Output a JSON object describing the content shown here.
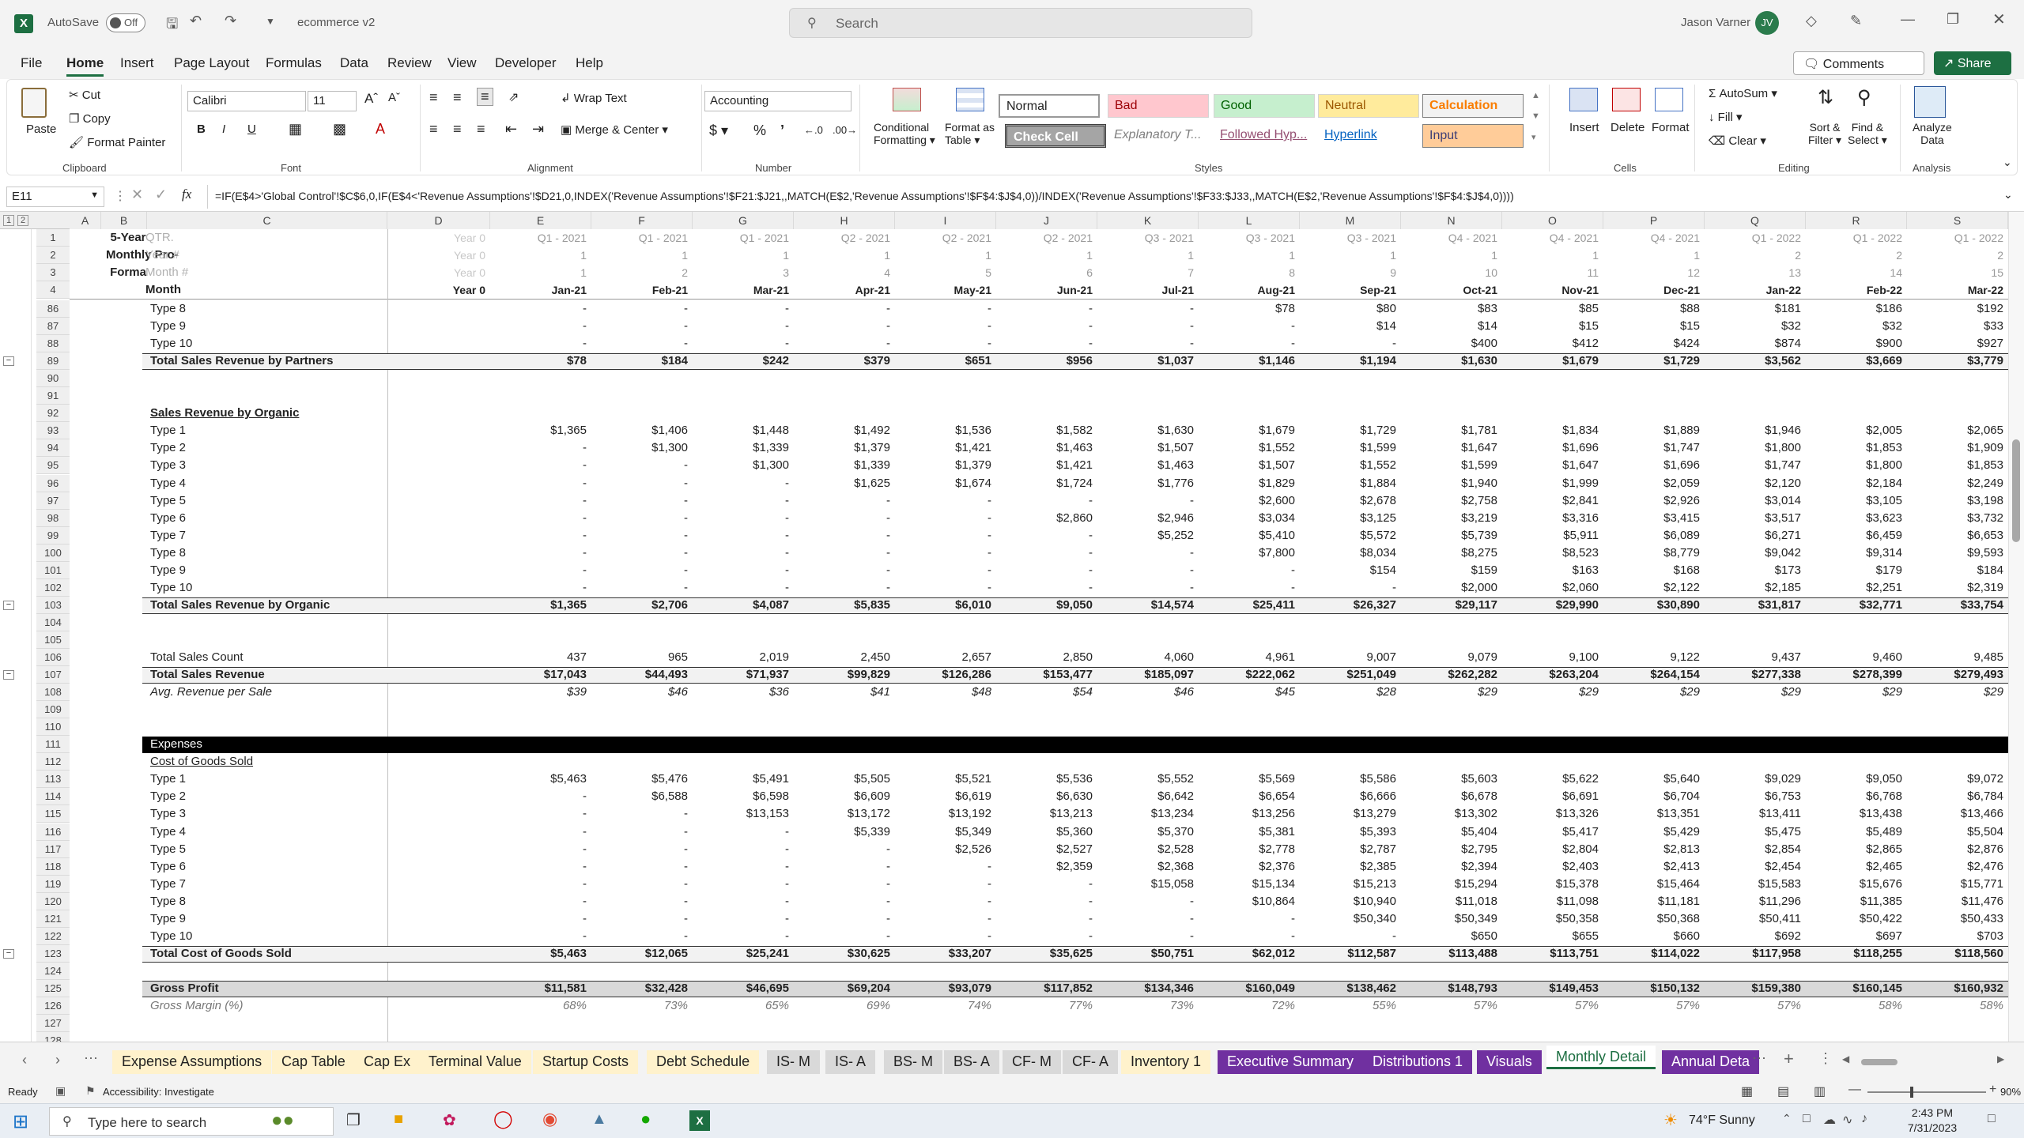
{
  "titlebar": {
    "autosave": "AutoSave",
    "autosave_state": "Off",
    "filename": "ecommerce v2",
    "search_placeholder": "Search",
    "user": "Jason Varner",
    "initials": "JV"
  },
  "menu": [
    "File",
    "Home",
    "Insert",
    "Page Layout",
    "Formulas",
    "Data",
    "Review",
    "View",
    "Developer",
    "Help"
  ],
  "menu_right": {
    "comments": "Comments",
    "share": "Share"
  },
  "ribbon": {
    "paste": "Paste",
    "cut": "Cut",
    "copy": "Copy",
    "format_painter": "Format Painter",
    "clipboard": "Clipboard",
    "font_name": "Calibri",
    "font_size": "11",
    "font": "Font",
    "wrap_text": "Wrap Text",
    "merge_center": "Merge & Center",
    "alignment": "Alignment",
    "number_format": "Accounting",
    "number": "Number",
    "cond_format": "Conditional",
    "cond_format2": "Formatting",
    "format_table": "Format as",
    "format_table2": "Table",
    "styles": [
      "Normal",
      "Bad",
      "Good",
      "Neutral",
      "Calculation",
      "Check Cell",
      "Explanatory T...",
      "Followed Hyp...",
      "Hyperlink",
      "Input"
    ],
    "styles_label": "Styles",
    "insert": "Insert",
    "delete": "Delete",
    "format": "Format",
    "cells": "Cells",
    "autosum": "AutoSum",
    "fill": "Fill",
    "clear": "Clear",
    "sort_filter": "Sort &",
    "sort_filter2": "Filter",
    "find_select": "Find &",
    "find_select2": "Select",
    "editing": "Editing",
    "analyze": "Analyze",
    "analyze2": "Data",
    "analysis": "Analysis"
  },
  "formula_bar": {
    "name_box": "E11",
    "fx": "fx",
    "formula": "=IF(E$4>'Global Control'!$C$6,0,IF(E$4<'Revenue Assumptions'!$D21,0,INDEX('Revenue Assumptions'!$F21:$J21,,MATCH(E$2,'Revenue Assumptions'!$F$4:$J$4,0))/INDEX('Revenue Assumptions'!$F33:$J33,,MATCH(E$2,'Revenue Assumptions'!$F$4:$J$4,0))))"
  },
  "columns": [
    "A",
    "B",
    "C",
    "D",
    "E",
    "F",
    "G",
    "H",
    "I",
    "J",
    "K",
    "L",
    "M",
    "N",
    "O",
    "P",
    "Q",
    "R",
    "S"
  ],
  "header_rows": {
    "label_b": [
      "5-Year",
      "Monthly Pro-",
      "Forma"
    ],
    "label_c": [
      "QTR.",
      "Year #",
      "Month #",
      "Month"
    ],
    "qtr": [
      "Year 0",
      "Q1 - 2021",
      "Q1 - 2021",
      "Q1 - 2021",
      "Q2 - 2021",
      "Q2 - 2021",
      "Q2 - 2021",
      "Q3 - 2021",
      "Q3 - 2021",
      "Q3 - 2021",
      "Q4 - 2021",
      "Q4 - 2021",
      "Q4 - 2021",
      "Q1 - 2022",
      "Q1 - 2022",
      "Q1 - 2022"
    ],
    "year": [
      "Year 0",
      "1",
      "1",
      "1",
      "1",
      "1",
      "1",
      "1",
      "1",
      "1",
      "1",
      "1",
      "1",
      "2",
      "2",
      "2"
    ],
    "monthnum": [
      "Year 0",
      "1",
      "2",
      "3",
      "4",
      "5",
      "6",
      "7",
      "8",
      "9",
      "10",
      "11",
      "12",
      "13",
      "14",
      "15"
    ],
    "month": [
      "Year 0",
      "Jan-21",
      "Feb-21",
      "Mar-21",
      "Apr-21",
      "May-21",
      "Jun-21",
      "Jul-21",
      "Aug-21",
      "Sep-21",
      "Oct-21",
      "Nov-21",
      "Dec-21",
      "Jan-22",
      "Feb-22",
      "Mar-22"
    ]
  },
  "rows": [
    {
      "n": "86",
      "label": "Type 8",
      "vals": [
        "",
        "-",
        "-",
        "-",
        "-",
        "-",
        "-",
        "-",
        "$78",
        "$80",
        "$83",
        "$85",
        "$88",
        "$181",
        "$186",
        "$192"
      ]
    },
    {
      "n": "87",
      "label": "Type 9",
      "vals": [
        "",
        "-",
        "-",
        "-",
        "-",
        "-",
        "-",
        "-",
        "-",
        "$14",
        "$14",
        "$15",
        "$15",
        "$32",
        "$32",
        "$33"
      ]
    },
    {
      "n": "88",
      "label": "Type 10",
      "vals": [
        "",
        "-",
        "-",
        "-",
        "-",
        "-",
        "-",
        "-",
        "-",
        "-",
        "$400",
        "$412",
        "$424",
        "$874",
        "$900",
        "$927"
      ]
    },
    {
      "n": "89",
      "label": "Total Sales Revenue by Partners",
      "bold": true,
      "total": true,
      "vals": [
        "",
        "$78",
        "$184",
        "$242",
        "$379",
        "$651",
        "$956",
        "$1,037",
        "$1,146",
        "$1,194",
        "$1,630",
        "$1,679",
        "$1,729",
        "$3,562",
        "$3,669",
        "$3,779"
      ]
    },
    {
      "n": "90",
      "label": "",
      "vals": []
    },
    {
      "n": "91",
      "label": "",
      "vals": []
    },
    {
      "n": "92",
      "label": "Sales Revenue by Organic",
      "bold": true,
      "underline": true,
      "vals": []
    },
    {
      "n": "93",
      "label": "Type 1",
      "vals": [
        "",
        "$1,365",
        "$1,406",
        "$1,448",
        "$1,492",
        "$1,536",
        "$1,582",
        "$1,630",
        "$1,679",
        "$1,729",
        "$1,781",
        "$1,834",
        "$1,889",
        "$1,946",
        "$2,005",
        "$2,065"
      ]
    },
    {
      "n": "94",
      "label": "Type 2",
      "vals": [
        "",
        "-",
        "$1,300",
        "$1,339",
        "$1,379",
        "$1,421",
        "$1,463",
        "$1,507",
        "$1,552",
        "$1,599",
        "$1,647",
        "$1,696",
        "$1,747",
        "$1,800",
        "$1,853",
        "$1,909"
      ]
    },
    {
      "n": "95",
      "label": "Type 3",
      "vals": [
        "",
        "-",
        "-",
        "$1,300",
        "$1,339",
        "$1,379",
        "$1,421",
        "$1,463",
        "$1,507",
        "$1,552",
        "$1,599",
        "$1,647",
        "$1,696",
        "$1,747",
        "$1,800",
        "$1,853"
      ]
    },
    {
      "n": "96",
      "label": "Type 4",
      "vals": [
        "",
        "-",
        "-",
        "-",
        "$1,625",
        "$1,674",
        "$1,724",
        "$1,776",
        "$1,829",
        "$1,884",
        "$1,940",
        "$1,999",
        "$2,059",
        "$2,120",
        "$2,184",
        "$2,249"
      ]
    },
    {
      "n": "97",
      "label": "Type 5",
      "vals": [
        "",
        "-",
        "-",
        "-",
        "-",
        "-",
        "-",
        "-",
        "$2,600",
        "$2,678",
        "$2,758",
        "$2,841",
        "$2,926",
        "$3,014",
        "$3,105",
        "$3,198"
      ]
    },
    {
      "n": "98",
      "label": "Type 6",
      "vals": [
        "",
        "-",
        "-",
        "-",
        "-",
        "-",
        "$2,860",
        "$2,946",
        "$3,034",
        "$3,125",
        "$3,219",
        "$3,316",
        "$3,415",
        "$3,517",
        "$3,623",
        "$3,732"
      ]
    },
    {
      "n": "99",
      "label": "Type 7",
      "vals": [
        "",
        "-",
        "-",
        "-",
        "-",
        "-",
        "-",
        "$5,252",
        "$5,410",
        "$5,572",
        "$5,739",
        "$5,911",
        "$6,089",
        "$6,271",
        "$6,459",
        "$6,653"
      ]
    },
    {
      "n": "100",
      "label": "Type 8",
      "vals": [
        "",
        "-",
        "-",
        "-",
        "-",
        "-",
        "-",
        "-",
        "$7,800",
        "$8,034",
        "$8,275",
        "$8,523",
        "$8,779",
        "$9,042",
        "$9,314",
        "$9,593"
      ]
    },
    {
      "n": "101",
      "label": "Type 9",
      "vals": [
        "",
        "-",
        "-",
        "-",
        "-",
        "-",
        "-",
        "-",
        "-",
        "$154",
        "$159",
        "$163",
        "$168",
        "$173",
        "$179",
        "$184"
      ]
    },
    {
      "n": "102",
      "label": "Type 10",
      "vals": [
        "",
        "-",
        "-",
        "-",
        "-",
        "-",
        "-",
        "-",
        "-",
        "-",
        "$2,000",
        "$2,060",
        "$2,122",
        "$2,185",
        "$2,251",
        "$2,319"
      ]
    },
    {
      "n": "103",
      "label": "Total Sales Revenue by Organic",
      "bold": true,
      "total": true,
      "vals": [
        "",
        "$1,365",
        "$2,706",
        "$4,087",
        "$5,835",
        "$6,010",
        "$9,050",
        "$14,574",
        "$25,411",
        "$26,327",
        "$29,117",
        "$29,990",
        "$30,890",
        "$31,817",
        "$32,771",
        "$33,754"
      ]
    },
    {
      "n": "104",
      "label": "",
      "vals": []
    },
    {
      "n": "105",
      "label": "",
      "vals": []
    },
    {
      "n": "106",
      "label": "Total Sales Count",
      "vals": [
        "",
        "437",
        "965",
        "2,019",
        "2,450",
        "2,657",
        "2,850",
        "4,060",
        "4,961",
        "9,007",
        "9,079",
        "9,100",
        "9,122",
        "9,437",
        "9,460",
        "9,485"
      ]
    },
    {
      "n": "107",
      "label": "Total Sales Revenue",
      "bold": true,
      "total": true,
      "vals": [
        "",
        "$17,043",
        "$44,493",
        "$71,937",
        "$99,829",
        "$126,286",
        "$153,477",
        "$185,097",
        "$222,062",
        "$251,049",
        "$262,282",
        "$263,204",
        "$264,154",
        "$277,338",
        "$278,399",
        "$279,493"
      ]
    },
    {
      "n": "108",
      "label": "Avg. Revenue per Sale",
      "italic": true,
      "vals": [
        "",
        "$39",
        "$46",
        "$36",
        "$41",
        "$48",
        "$54",
        "$46",
        "$45",
        "$28",
        "$29",
        "$29",
        "$29",
        "$29",
        "$29",
        "$29"
      ]
    },
    {
      "n": "109",
      "label": "",
      "vals": []
    },
    {
      "n": "110",
      "label": "",
      "vals": []
    },
    {
      "n": "111",
      "label": "Expenses",
      "black": true,
      "vals": []
    },
    {
      "n": "112",
      "label": "Cost of Goods Sold",
      "underline": true,
      "vals": []
    },
    {
      "n": "113",
      "label": "Type 1",
      "vals": [
        "",
        "$5,463",
        "$5,476",
        "$5,491",
        "$5,505",
        "$5,521",
        "$5,536",
        "$5,552",
        "$5,569",
        "$5,586",
        "$5,603",
        "$5,622",
        "$5,640",
        "$9,029",
        "$9,050",
        "$9,072"
      ]
    },
    {
      "n": "114",
      "label": "Type 2",
      "vals": [
        "",
        "-",
        "$6,588",
        "$6,598",
        "$6,609",
        "$6,619",
        "$6,630",
        "$6,642",
        "$6,654",
        "$6,666",
        "$6,678",
        "$6,691",
        "$6,704",
        "$6,753",
        "$6,768",
        "$6,784"
      ]
    },
    {
      "n": "115",
      "label": "Type 3",
      "vals": [
        "",
        "-",
        "-",
        "$13,153",
        "$13,172",
        "$13,192",
        "$13,213",
        "$13,234",
        "$13,256",
        "$13,279",
        "$13,302",
        "$13,326",
        "$13,351",
        "$13,411",
        "$13,438",
        "$13,466"
      ]
    },
    {
      "n": "116",
      "label": "Type 4",
      "vals": [
        "",
        "-",
        "-",
        "-",
        "$5,339",
        "$5,349",
        "$5,360",
        "$5,370",
        "$5,381",
        "$5,393",
        "$5,404",
        "$5,417",
        "$5,429",
        "$5,475",
        "$5,489",
        "$5,504"
      ]
    },
    {
      "n": "117",
      "label": "Type 5",
      "vals": [
        "",
        "-",
        "-",
        "-",
        "-",
        "$2,526",
        "$2,527",
        "$2,528",
        "$2,778",
        "$2,787",
        "$2,795",
        "$2,804",
        "$2,813",
        "$2,854",
        "$2,865",
        "$2,876"
      ]
    },
    {
      "n": "118",
      "label": "Type 6",
      "vals": [
        "",
        "-",
        "-",
        "-",
        "-",
        "-",
        "$2,359",
        "$2,368",
        "$2,376",
        "$2,385",
        "$2,394",
        "$2,403",
        "$2,413",
        "$2,454",
        "$2,465",
        "$2,476"
      ]
    },
    {
      "n": "119",
      "label": "Type 7",
      "vals": [
        "",
        "-",
        "-",
        "-",
        "-",
        "-",
        "-",
        "$15,058",
        "$15,134",
        "$15,213",
        "$15,294",
        "$15,378",
        "$15,464",
        "$15,583",
        "$15,676",
        "$15,771"
      ]
    },
    {
      "n": "120",
      "label": "Type 8",
      "vals": [
        "",
        "-",
        "-",
        "-",
        "-",
        "-",
        "-",
        "-",
        "$10,864",
        "$10,940",
        "$11,018",
        "$11,098",
        "$11,181",
        "$11,296",
        "$11,385",
        "$11,476"
      ]
    },
    {
      "n": "121",
      "label": "Type 9",
      "vals": [
        "",
        "-",
        "-",
        "-",
        "-",
        "-",
        "-",
        "-",
        "-",
        "$50,340",
        "$50,349",
        "$50,358",
        "$50,368",
        "$50,411",
        "$50,422",
        "$50,433"
      ]
    },
    {
      "n": "122",
      "label": "Type 10",
      "vals": [
        "",
        "-",
        "-",
        "-",
        "-",
        "-",
        "-",
        "-",
        "-",
        "-",
        "$650",
        "$655",
        "$660",
        "$692",
        "$697",
        "$703"
      ]
    },
    {
      "n": "123",
      "label": "Total Cost of Goods Sold",
      "bold": true,
      "total": true,
      "vals": [
        "",
        "$5,463",
        "$12,065",
        "$25,241",
        "$30,625",
        "$33,207",
        "$35,625",
        "$50,751",
        "$62,012",
        "$112,587",
        "$113,488",
        "$113,751",
        "$114,022",
        "$117,958",
        "$118,255",
        "$118,560"
      ]
    },
    {
      "n": "124",
      "label": "",
      "vals": []
    },
    {
      "n": "125",
      "label": "Gross Profit",
      "bold": true,
      "gray": true,
      "vals": [
        "",
        "$11,581",
        "$32,428",
        "$46,695",
        "$69,204",
        "$93,079",
        "$117,852",
        "$134,346",
        "$160,049",
        "$138,462",
        "$148,793",
        "$149,453",
        "$150,132",
        "$159,380",
        "$160,145",
        "$160,932"
      ]
    },
    {
      "n": "126",
      "label": "Gross Margin (%)",
      "italic": true,
      "muted": true,
      "vals": [
        "",
        "68%",
        "73%",
        "65%",
        "69%",
        "74%",
        "77%",
        "73%",
        "72%",
        "55%",
        "57%",
        "57%",
        "57%",
        "57%",
        "58%",
        "58%"
      ]
    },
    {
      "n": "127",
      "label": "",
      "vals": []
    },
    {
      "n": "128",
      "label": "",
      "vals": []
    }
  ],
  "tabs": [
    {
      "label": "Expense Assumptions",
      "style": "y"
    },
    {
      "label": "Cap Table",
      "style": "y"
    },
    {
      "label": "Cap Ex",
      "style": "y"
    },
    {
      "label": "Terminal Value",
      "style": "y"
    },
    {
      "label": "Startup Costs",
      "style": "y"
    },
    {
      "label": "Debt Schedule",
      "style": "y"
    },
    {
      "label": "IS- M",
      "style": "g"
    },
    {
      "label": "IS- A",
      "style": "g"
    },
    {
      "label": "BS- M",
      "style": "g"
    },
    {
      "label": "BS- A",
      "style": "g"
    },
    {
      "label": "CF- M",
      "style": "g"
    },
    {
      "label": "CF- A",
      "style": "g"
    },
    {
      "label": "Inventory 1",
      "style": "y"
    },
    {
      "label": "Executive Summary",
      "style": "p"
    },
    {
      "label": "Distributions 1",
      "style": "p"
    },
    {
      "label": "Visuals",
      "style": "p"
    },
    {
      "label": "Monthly Detail",
      "style": "active"
    },
    {
      "label": "Annual Deta",
      "style": "p"
    }
  ],
  "status": {
    "ready": "Ready",
    "accessibility": "Accessibility: Investigate",
    "zoom": "90%"
  },
  "taskbar": {
    "search_placeholder": "Type here to search",
    "weather": "74°F  Sunny",
    "time": "2:43 PM",
    "date": "7/31/2023"
  }
}
